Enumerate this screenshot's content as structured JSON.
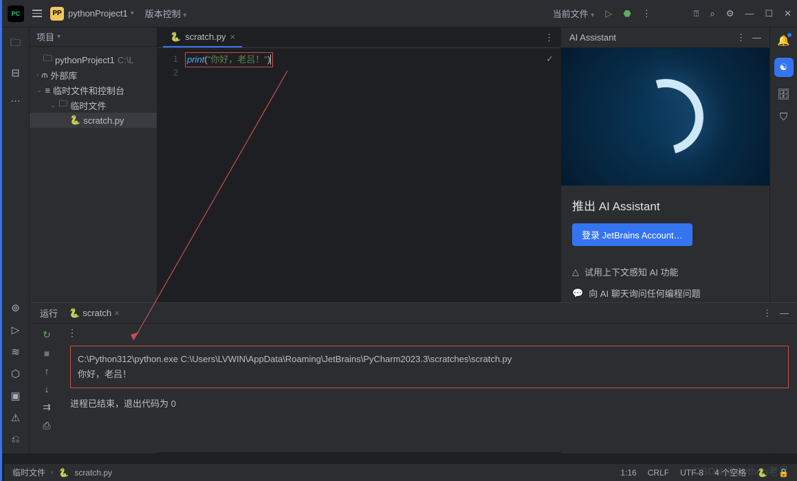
{
  "titlebar": {
    "project_name": "pythonProject1",
    "version_control": "版本控制",
    "current_file": "当前文件"
  },
  "sidebar": {
    "header": "项目",
    "project_root": "pythonProject1",
    "project_path": "C:\\L",
    "external": "外部库",
    "scratches_console": "临时文件和控制台",
    "scratches": "临时文件",
    "scratch_file": "scratch.py"
  },
  "editor": {
    "filename": "scratch.py",
    "line1_num": "1",
    "line2_num": "2",
    "code_print": "print",
    "code_open": "(",
    "code_str": "\"你好，老吕！\"",
    "code_close": ")"
  },
  "ai": {
    "header": "AI Assistant",
    "title": "推出 AI Assistant",
    "login": "登录 JetBrains Account…",
    "link1": "试用上下文感知 AI 功能",
    "link2": "向 AI 聊天询问任何编程问题"
  },
  "run": {
    "label": "运行",
    "tab": "scratch",
    "cmd": "C:\\Python312\\python.exe C:\\Users\\LVWIN\\AppData\\Roaming\\JetBrains\\PyCharm2023.3\\scratches\\scratch.py",
    "output": "你好，老吕！",
    "exit": "进程已结束，退出代码为 0"
  },
  "status": {
    "breadcrumb1": "临时文件",
    "breadcrumb2": "scratch.py",
    "pos": "1:16",
    "crlf": "CRLF",
    "enc": "UTF-8",
    "spaces": "4 个空格"
  }
}
